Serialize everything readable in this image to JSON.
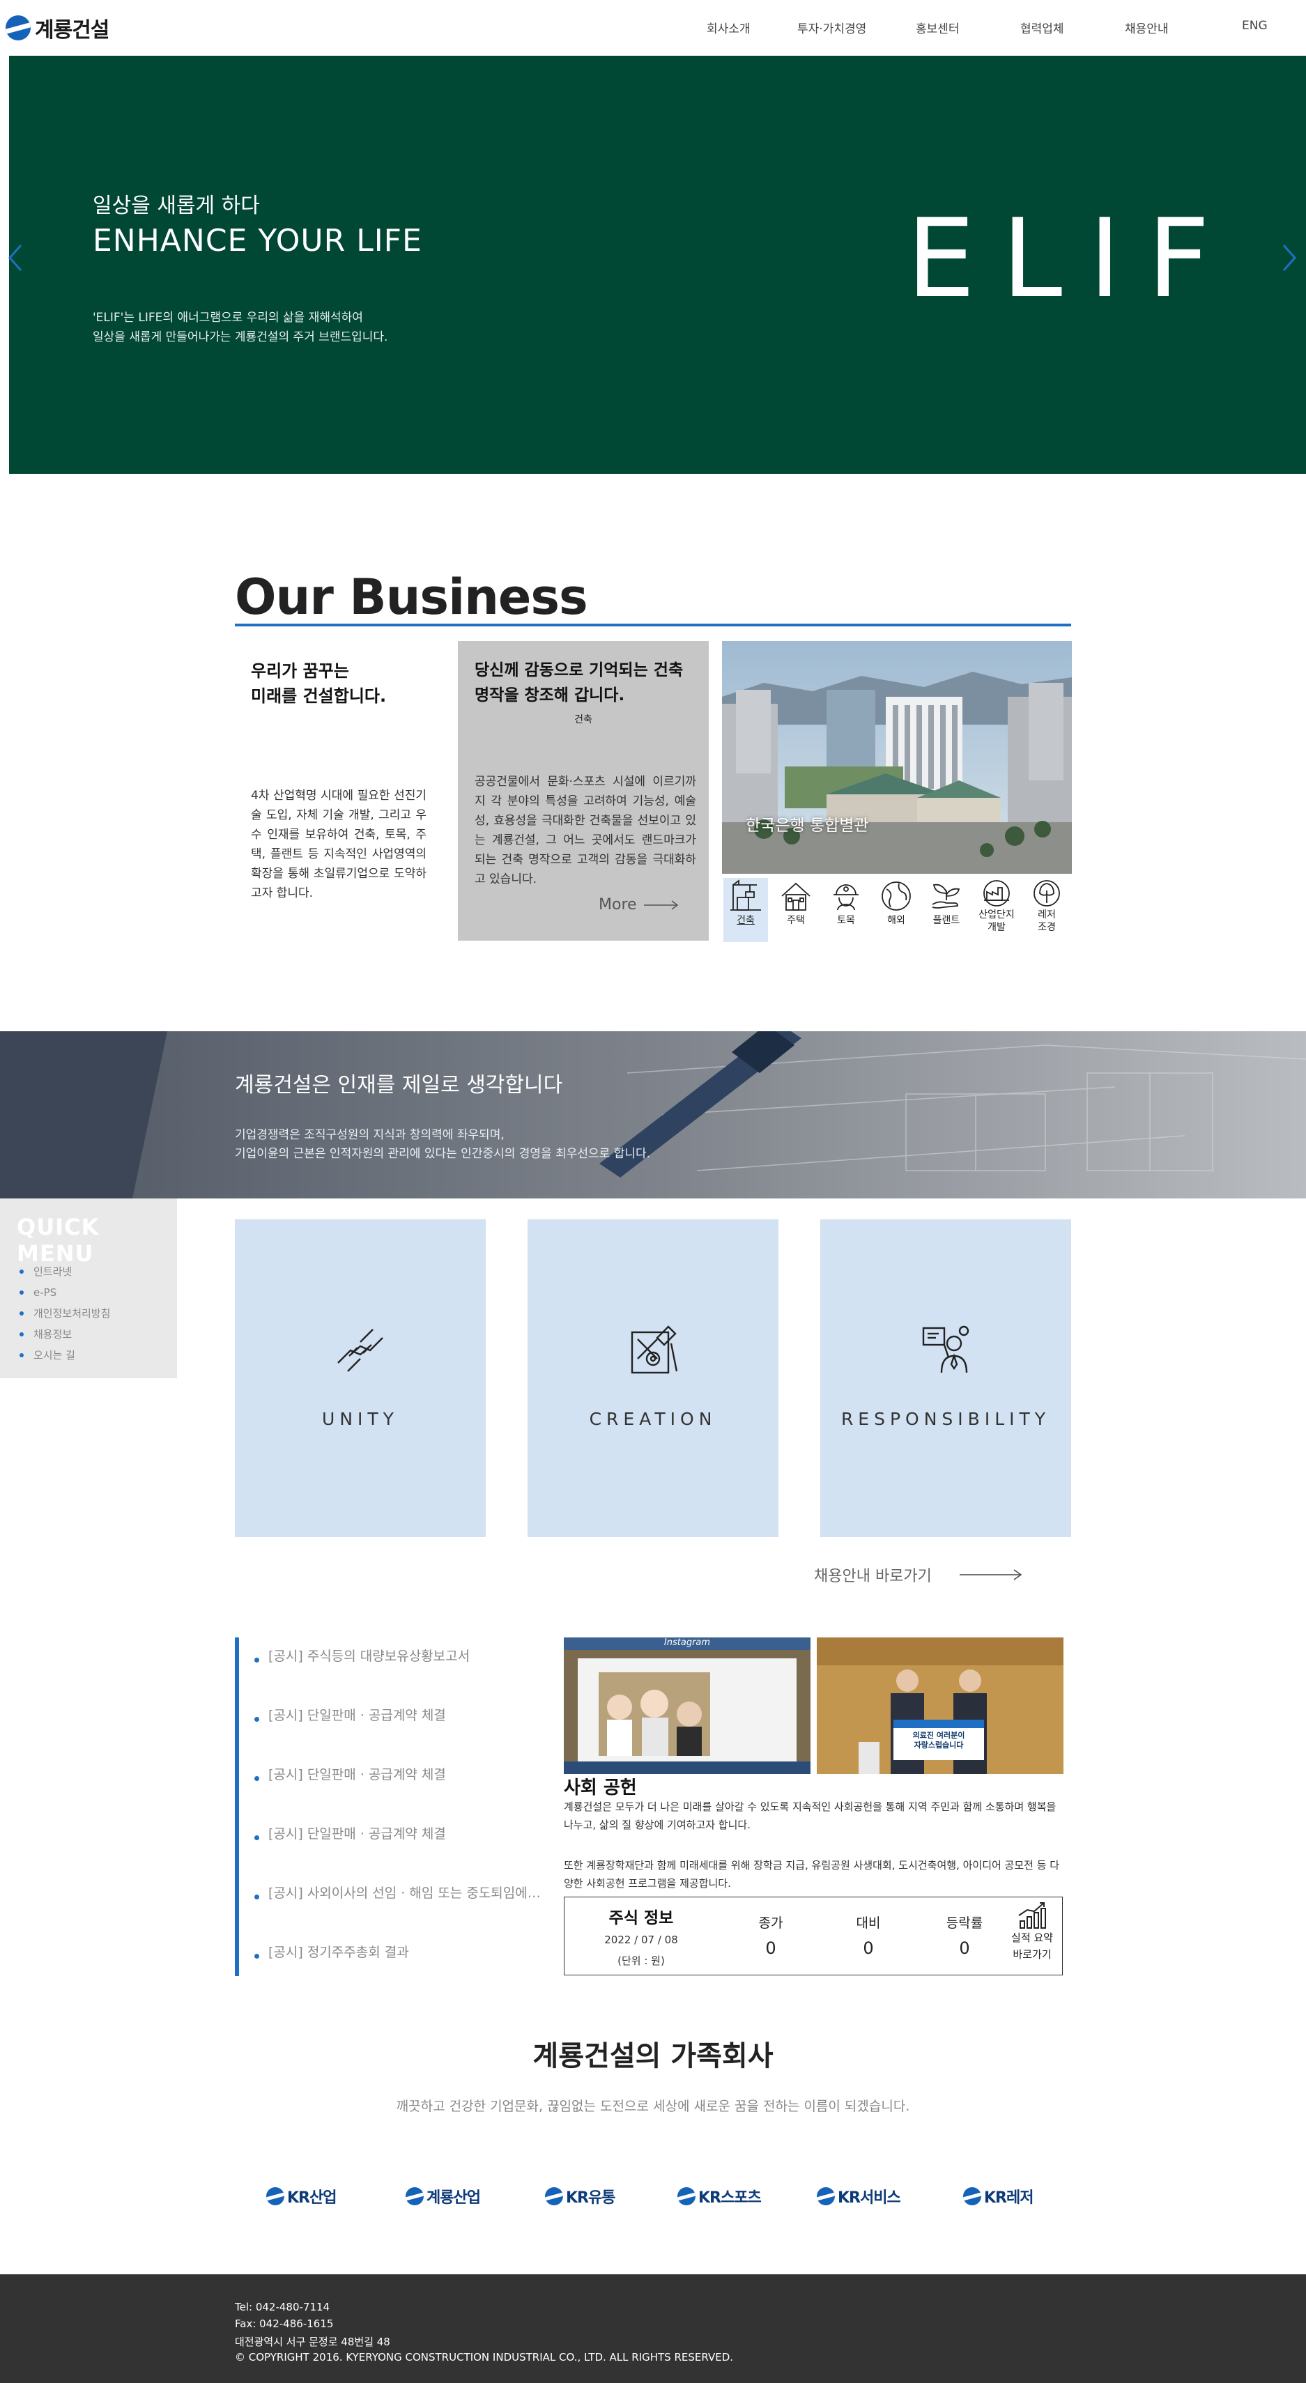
{
  "header": {
    "logo_text": "계룡건설",
    "nav": [
      "회사소개",
      "투자·가치경영",
      "홍보센터",
      "협력업체",
      "채용안내",
      "ENG"
    ]
  },
  "hero": {
    "subtitle": "일상을 새롭게 하다",
    "title": "ENHANCE YOUR LIFE",
    "desc_line1": "'ELIF'는 LIFE의 애너그램으로 우리의 삶을 재해석하여",
    "desc_line2": "일상을 새롭게 만들어나가는 계룡건설의 주거 브랜드입니다.",
    "brand": "ELIF",
    "bg_color": "#004734",
    "arrow_color": "#1f6fc4"
  },
  "business": {
    "title": "Our Business",
    "left_heading_1": "우리가 꿈꾸는",
    "left_heading_2": "미래를 건설합니다.",
    "left_text": "4차 산업혁명 시대에 필요한 선진기술 도입, 자체 기술 개발, 그리고 우수 인재를 보유하여 건축, 토목, 주택, 플랜트 등 지속적인 사업영역의 확장을 통해 초일류기업으로 도약하고자 합니다.",
    "card_heading_1": "당신께 감동으로 기억되는 건축",
    "card_heading_2": "명작을 창조해 갑니다.",
    "card_category": "건축",
    "card_text": "공공건물에서 문화·스포츠 시설에 이르기까지 각 분야의 특성을 고려하여 기능성, 예술성, 효용성을 극대화한 건축물을 선보이고 있는 계룡건설, 그 어느 곳에서도 랜드마크가 되는 건축 명작으로 고객의 감동을 극대화하고 있습니다.",
    "more": "More",
    "photo_caption": "한국은행 통합별관",
    "icons": [
      {
        "name": "building-crane-icon",
        "label_1": "건축",
        "label_2": "",
        "active": true
      },
      {
        "name": "house-icon",
        "label_1": "주택",
        "label_2": ""
      },
      {
        "name": "worker-helmet-icon",
        "label_1": "토목",
        "label_2": ""
      },
      {
        "name": "globe-icon",
        "label_1": "해외",
        "label_2": ""
      },
      {
        "name": "plant-icon",
        "label_1": "플랜트",
        "label_2": ""
      },
      {
        "name": "industrial-complex-icon",
        "label_1": "산업단지",
        "label_2": "개발"
      },
      {
        "name": "tree-icon",
        "label_1": "레저",
        "label_2": "조경"
      }
    ]
  },
  "talent": {
    "heading": "계룡건설은 인재를 제일로 생각합니다",
    "line1": "기업경쟁력은 조직구성원의 지식과 창의력에 좌우되며,",
    "line2": "기업이윤의 근본은 인적자원의 관리에 있다는 인간중시의 경영을 최우선으로 합니다."
  },
  "quick_menu": {
    "title": "QUICK MENU",
    "items": [
      "인트라넷",
      "e-PS",
      "개인정보처리방침",
      "채용정보",
      "오시는 길"
    ]
  },
  "values": [
    {
      "icon": "handshake-icon",
      "label": "UNITY"
    },
    {
      "icon": "design-tools-icon",
      "label": "CREATION"
    },
    {
      "icon": "presenter-icon",
      "label": "RESPONSIBILITY"
    }
  ],
  "recruit_link": "채용안내 바로가기",
  "notices": [
    "[공시] 주식등의 대량보유상황보고서",
    "[공시] 단일판매 · 공급계약 체결",
    "[공시] 단일판매 · 공급계약 체결",
    "[공시] 단일판매 · 공급계약 체결",
    "[공시] 사외이사의 선임 · 해임 또는 중도퇴임에 관한 신고",
    "[공시] 정기주주총회 결과"
  ],
  "social": {
    "photo1_header": "Instagram",
    "photo2_sign_1": "의료진 여러분이",
    "photo2_sign_2": "자랑스럽습니다",
    "heading": "사회 공헌",
    "text1": "계룡건설은 모두가 더 나은 미래를 살아갈 수 있도록 지속적인 사회공헌을 통해 지역 주민과 함께 소통하며 행복을 나누고, 삶의 질 향상에 기여하고자 합니다.",
    "text2": "또한 계룡장학재단과 함께 미래세대를 위해 장학금 지급, 유림공원 사생대회, 도시건축여행, 아이디어 공모전 등 다양한 사회공헌 프로그램을 제공합니다."
  },
  "stock": {
    "title": "주식 정보",
    "date": "2022 / 07 / 08",
    "unit": "(단위 : 원)",
    "cols": [
      {
        "key": "종가",
        "value": "0"
      },
      {
        "key": "대비",
        "value": "0"
      },
      {
        "key": "등락률",
        "value": "0"
      }
    ],
    "summary_1": "실적 요약",
    "summary_2": "바로가기"
  },
  "family": {
    "title": "계룡건설의 가족회사",
    "desc": "깨끗하고 건강한 기업문화, 끊임없는 도전으로 세상에 새로운 꿈을 전하는 이름이 되겠습니다.",
    "companies": [
      "KR산업",
      "계룡산업",
      "KR유통",
      "KR스포츠",
      "KR서비스",
      "KR레저"
    ]
  },
  "footer": {
    "tel": "Tel: 042-480-7114",
    "fax": "Fax: 042-486-1615",
    "address": "대전광역시 서구 문정로 48번길 48",
    "copyright": "© COPYRIGHT 2016. KYERYONG CONSTRUCTION INDUSTRIAL CO., LTD. ALL RIGHTS RESERVED."
  }
}
